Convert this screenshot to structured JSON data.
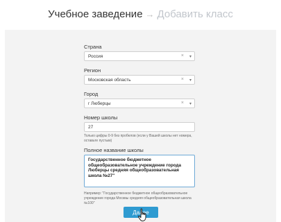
{
  "header": {
    "title": "Учебное заведение",
    "arrow": "→",
    "step": "Добавить класс"
  },
  "form": {
    "country": {
      "label": "Страна",
      "value": "Россия",
      "clear": "×",
      "caret": "▾"
    },
    "region": {
      "label": "Регион",
      "value": "Московская область",
      "clear": "×",
      "caret": "▾"
    },
    "city": {
      "label": "Город",
      "value": "г Люберцы",
      "clear": "×",
      "caret": "▾"
    },
    "school_number": {
      "label": "Номер школы",
      "value": "27",
      "hint": "Только цифры 0-9 без пробелов (если у Вашей школы нет номера, оставьте пустым)"
    },
    "full_name": {
      "label": "Полное название школы",
      "value": "Государственное бюджетное общеобразовательное учреждение города Люберцы средняя общеобразовательная школа №27\"",
      "hint": "Например: \"Государственное бюджетное общеобразовательное учреждение города Москвы средняя общеобразовательная школа №100\""
    },
    "submit_label": "Далее"
  }
}
